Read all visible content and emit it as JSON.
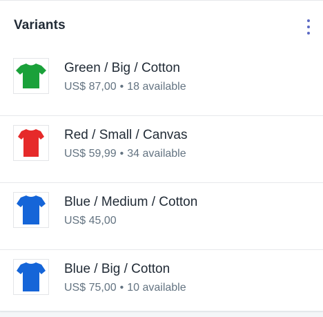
{
  "card": {
    "title": "Variants",
    "menu_icon": "more-vertical-icon",
    "accent": "#5c6ac4"
  },
  "variants": [
    {
      "title": "Green / Big / Cotton",
      "price": "US$ 87,00",
      "separator": "•",
      "availability": "18 available",
      "shirt_color": "#1aa13a",
      "icon": "tshirt-icon"
    },
    {
      "title": "Red / Small / Canvas",
      "price": "US$ 59,99",
      "separator": "•",
      "availability": "34 available",
      "shirt_color": "#e62a2a",
      "icon": "tshirt-icon"
    },
    {
      "title": "Blue / Medium / Cotton",
      "price": "US$ 45,00",
      "separator": "",
      "availability": "",
      "shirt_color": "#1565d8",
      "icon": "tshirt-icon"
    },
    {
      "title": "Blue / Big / Cotton",
      "price": "US$ 75,00",
      "separator": "•",
      "availability": "10 available",
      "shirt_color": "#1565d8",
      "icon": "tshirt-icon"
    }
  ]
}
